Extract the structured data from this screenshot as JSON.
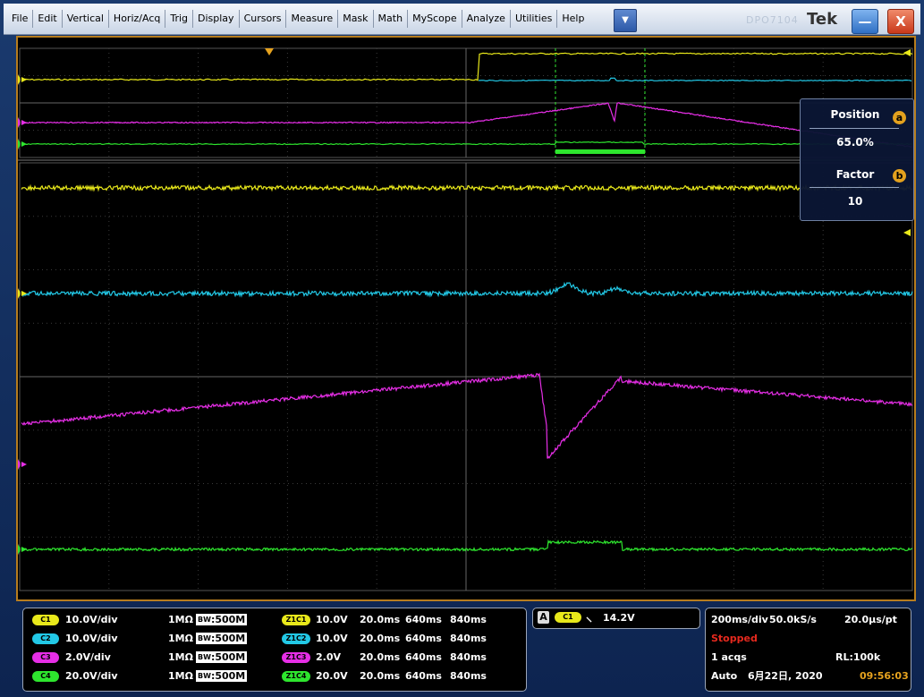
{
  "menu": [
    "File",
    "Edit",
    "Vertical",
    "Horiz/Acq",
    "Trig",
    "Display",
    "Cursors",
    "Measure",
    "Mask",
    "Math",
    "MyScope",
    "Analyze",
    "Utilities",
    "Help"
  ],
  "titlebar": {
    "model": "DPO7104",
    "brand": "Tek",
    "dropdown_icon": "triangle-down",
    "minimize": "—",
    "close": "X"
  },
  "zoom": {
    "position_label": "Position",
    "position_knob": "a",
    "position_value": "65.0%",
    "factor_label": "Factor",
    "factor_knob": "b",
    "factor_value": "10"
  },
  "markers": {
    "ch1": "1",
    "ch3": "3",
    "ch4": "4"
  },
  "channels": [
    {
      "id": "C1",
      "scale": "10.0V/div",
      "imp": "1MΩ",
      "bw_b": "B",
      "bw_w": "W",
      "bw": ":500M",
      "zoom": "Z1C1",
      "zscale": "10.0V",
      "t1": "20.0ms",
      "t2": "640ms",
      "t3": "840ms",
      "color": "#e8e81a"
    },
    {
      "id": "C2",
      "scale": "10.0V/div",
      "imp": "1MΩ",
      "bw_b": "B",
      "bw_w": "W",
      "bw": ":500M",
      "zoom": "Z1C2",
      "zscale": "10.0V",
      "t1": "20.0ms",
      "t2": "640ms",
      "t3": "840ms",
      "color": "#22c8e6"
    },
    {
      "id": "C3",
      "scale": "2.0V/div",
      "imp": "1MΩ",
      "bw_b": "B",
      "bw_w": "W",
      "bw": ":500M",
      "zoom": "Z1C3",
      "zscale": "2.0V",
      "t1": "20.0ms",
      "t2": "640ms",
      "t3": "840ms",
      "color": "#e62ee6"
    },
    {
      "id": "C4",
      "scale": "20.0V/div",
      "imp": "1MΩ",
      "bw_b": "B",
      "bw_w": "W",
      "bw": ":500M",
      "zoom": "Z1C4",
      "zscale": "20.0V",
      "t1": "20.0ms",
      "t2": "640ms",
      "t3": "840ms",
      "color": "#2ee62e"
    }
  ],
  "trigger": {
    "mode": "A",
    "source": "C1",
    "slope": "falling",
    "level": "14.2V"
  },
  "acquisition": {
    "timebase": "200ms/div",
    "rate": "50.0kS/s",
    "resolution": "20.0μs/pt",
    "state": "Stopped",
    "acqs": "1 acqs",
    "rl": "RL:100k",
    "mode": "Auto",
    "date": "6月22日, 2020",
    "time": "09:56:03"
  },
  "colors": {
    "ch1": "#e8e81a",
    "ch2": "#22c8e6",
    "ch3": "#e62ee6",
    "ch4": "#2ee62e",
    "bezel": "#b77d1e",
    "stopped": "#e6291e",
    "clock": "#e6a21e"
  }
}
